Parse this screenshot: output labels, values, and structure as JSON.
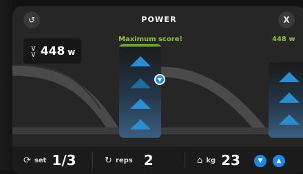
{
  "header": {
    "title": "POWER",
    "reset_icon": "reset-icon",
    "close_label": "X"
  },
  "power_display": {
    "value": "448",
    "unit": "w",
    "chevron_icon": "double-chevron-down-icon"
  },
  "track": {
    "max_score_label": "Maximum score!",
    "right_watts_label": "448 w",
    "marker_icon": "chevron-down-icon"
  },
  "footer": {
    "set_label": "set",
    "set_value": "1/3",
    "reps_label": "reps",
    "reps_value": "2",
    "kg_label": "kg",
    "kg_value": "23",
    "set_icon": "set-icon",
    "reps_icon": "repeat-icon",
    "kg_icon": "weight-icon",
    "decrease_icon": "chevron-down-icon",
    "increase_icon": "chevron-up-icon"
  },
  "colors": {
    "accent_blue": "#1e88e5",
    "score_green": "#8bc53f",
    "panel_bg": "#262626",
    "footer_bg": "#1b1b1b"
  }
}
